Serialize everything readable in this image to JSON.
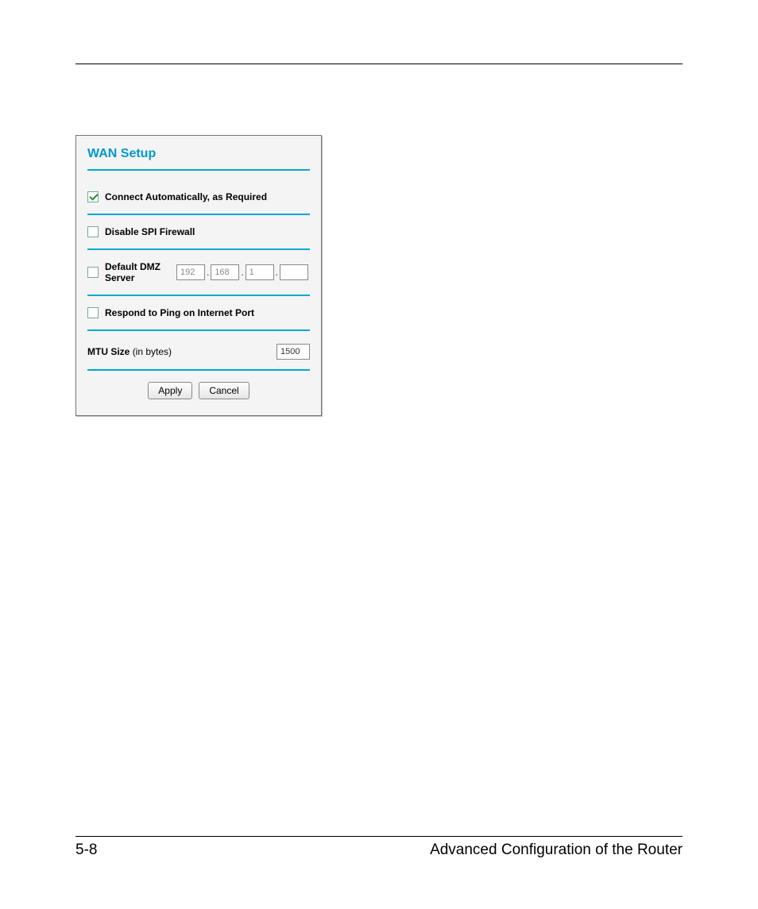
{
  "footer": {
    "page_number": "5-8",
    "section_title": "Advanced Configuration of the Router"
  },
  "wan_panel": {
    "title": "WAN Setup",
    "rows": {
      "connect_auto": {
        "label": "Connect Automatically, as Required",
        "checked": true
      },
      "disable_spi": {
        "label": "Disable SPI Firewall",
        "checked": false
      },
      "default_dmz": {
        "label": "Default DMZ Server",
        "checked": false,
        "ip": [
          "192",
          "168",
          "1",
          ""
        ]
      },
      "respond_ping": {
        "label": "Respond to Ping on Internet Port",
        "checked": false
      },
      "mtu": {
        "label": "MTU Size",
        "unit_hint": "(in bytes)",
        "value": "1500"
      }
    },
    "buttons": {
      "apply": "Apply",
      "cancel": "Cancel"
    }
  }
}
